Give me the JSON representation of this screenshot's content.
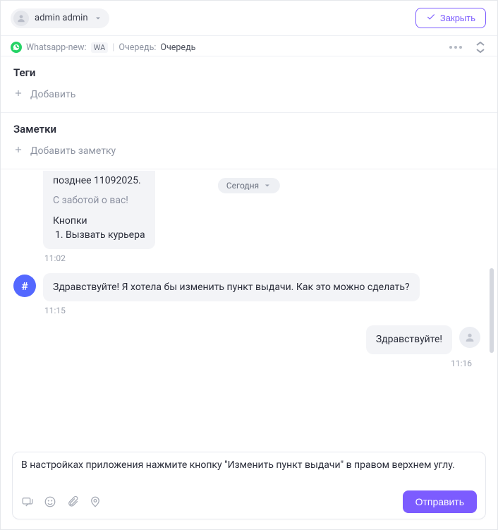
{
  "header": {
    "assignee_name": "admin admin",
    "close_label": "Закрыть"
  },
  "subheader": {
    "channel_name": "Whatsapp-new:",
    "channel_code": "WA",
    "queue_label": "Очередь:",
    "queue_value": "Очередь"
  },
  "tags": {
    "title": "Теги",
    "add_label": "Добавить"
  },
  "notes": {
    "title": "Заметки",
    "add_label": "Добавить заметку"
  },
  "chat": {
    "date_label": "Сегодня",
    "prev_message": {
      "line1": "позднее 11092025.",
      "signoff": "С заботой о вас!",
      "buttons_label": "Кнопки",
      "button1": "Вызвать курьера",
      "time": "11:02"
    },
    "client_message": {
      "avatar_symbol": "#",
      "text": "Здравствуйте! Я хотела бы изменить пункт выдачи. Как это можно сделать?",
      "time": "11:15"
    },
    "operator_message": {
      "text": "Здравствуйте!",
      "time": "11:16"
    }
  },
  "composer": {
    "draft": "В настройках приложения нажмите кнопку \"Изменить пункт выдачи\" в правом верхнем углу.",
    "send_label": "Отправить"
  }
}
